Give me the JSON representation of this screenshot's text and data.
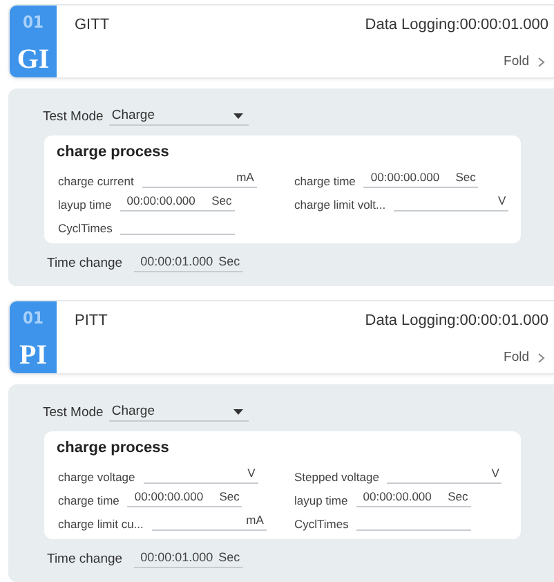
{
  "cards": [
    {
      "number": "01",
      "abbr": "GI",
      "name": "GITT",
      "logging": "Data Logging:00:00:01.000",
      "fold": "Fold",
      "test_mode": {
        "label": "Test Mode",
        "value": "Charge"
      },
      "section": {
        "title": "charge process",
        "rows": [
          [
            {
              "label": "charge current",
              "unit": "mA"
            },
            {
              "label": "charge time",
              "value": "00:00:00.000",
              "unit": "Sec"
            }
          ],
          [
            {
              "label": "layup time",
              "value": "00:00:00.000",
              "unit": "Sec"
            },
            {
              "label": "charge limit volt...",
              "unit": "V"
            }
          ],
          [
            {
              "label": "CyclTimes"
            }
          ]
        ]
      },
      "time_change": {
        "label": "Time change",
        "value": "00:00:01.000",
        "unit": "Sec"
      }
    },
    {
      "number": "01",
      "abbr": "PI",
      "name": "PITT",
      "logging": "Data Logging:00:00:01.000",
      "fold": "Fold",
      "test_mode": {
        "label": "Test Mode",
        "value": "Charge"
      },
      "section": {
        "title": "charge process",
        "rows": [
          [
            {
              "label": "charge voltage",
              "unit": "V"
            },
            {
              "label": "Stepped voltage",
              "unit": "V"
            }
          ],
          [
            {
              "label": "charge time",
              "value": "00:00:00.000",
              "unit": "Sec"
            },
            {
              "label": "layup time",
              "value": "00:00:00.000",
              "unit": "Sec"
            }
          ],
          [
            {
              "label": "charge limit cu...",
              "unit": "mA"
            },
            {
              "label": "CyclTimes"
            }
          ]
        ]
      },
      "time_change": {
        "label": "Time change",
        "value": "00:00:01.000",
        "unit": "Sec"
      }
    }
  ]
}
